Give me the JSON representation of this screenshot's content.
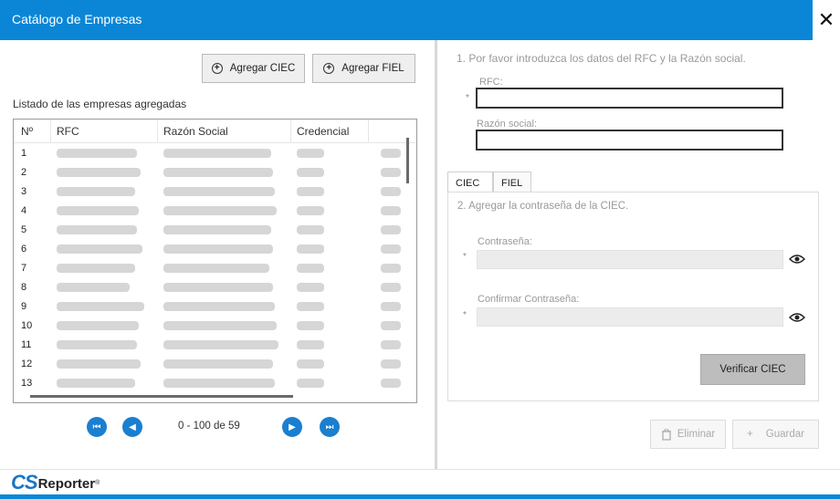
{
  "window": {
    "title": "Catálogo de Empresas",
    "close_glyph": "✕"
  },
  "toolbar": {
    "add_ciec_label": "Agregar CIEC",
    "add_fiel_label": "Agregar FIEL"
  },
  "list": {
    "label": "Listado de las empresas agregadas",
    "columns": [
      "Nº",
      "RFC",
      "Razón Social",
      "Credencial"
    ],
    "row_numbers": [
      "1",
      "2",
      "3",
      "4",
      "5",
      "6",
      "7",
      "8",
      "9",
      "10",
      "11",
      "12",
      "13"
    ]
  },
  "pagination": {
    "text": "0 - 100 de 59"
  },
  "form": {
    "step1": "1. Por favor introduzca los datos del RFC y la Razón social.",
    "rfc_label": "RFC:",
    "razon_label": "Razón social:",
    "required_mark": "*"
  },
  "tabs": [
    {
      "label": "CIEC"
    },
    {
      "label": "FIEL"
    }
  ],
  "ciec_panel": {
    "step2": "2. Agregar la contraseña de la CIEC.",
    "password_label": "Contraseña:",
    "confirm_label": "Confirmar Contraseña:",
    "verify_label": "Verificar CIEC"
  },
  "actions": {
    "delete_label": "Eliminar",
    "save_label": "Guardar"
  },
  "footer": {
    "logo_cs": "CS",
    "logo_reporter": "Reporter",
    "logo_reg": "®"
  },
  "colors": {
    "accent": "#0b86d6",
    "nav_button": "#1a7fd0"
  }
}
